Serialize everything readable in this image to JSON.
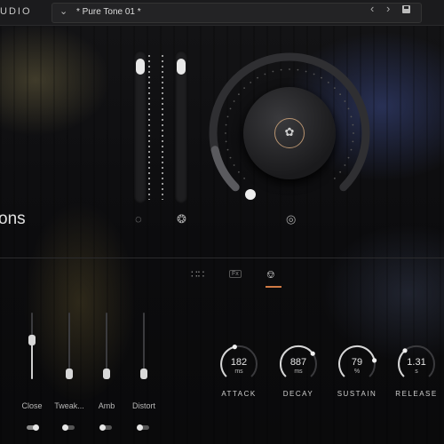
{
  "header": {
    "brand": "UDIO",
    "preset_name": "* Pure Tone 01 *",
    "chevron_icon": "chevron-down-icon",
    "prev_icon": "chevron-left-icon",
    "next_icon": "chevron-right-icon",
    "save_icon": "save-icon"
  },
  "left_panel": {
    "title_fragment": "ons"
  },
  "main_controls": {
    "slider_1_level": 0.95,
    "slider_2_level": 0.95,
    "slider_1_icon": "circles-icon",
    "slider_2_icon": "aperture-icon",
    "knob_icon": "sparkle-badge-icon",
    "knob_level": 0.12,
    "knob_footer_icon": "target-icon",
    "accent": "#d07a45"
  },
  "tabs": [
    {
      "name": "grid-tab",
      "icon": "grid-icon"
    },
    {
      "name": "fx-tab",
      "icon": "fx-icon",
      "label": "Fx"
    },
    {
      "name": "mixer-tab",
      "icon": "sliders-icon",
      "active": true
    }
  ],
  "macros": [
    {
      "label": "Close",
      "level": 0.6,
      "toggle_on": true
    },
    {
      "label": "Tweak...",
      "level": 0.0,
      "toggle_on": false
    },
    {
      "label": "Amb",
      "level": 0.0,
      "toggle_on": false
    },
    {
      "label": "Distort",
      "level": 0.0,
      "toggle_on": false
    }
  ],
  "envelope": [
    {
      "label": "ATTACK",
      "value": "182",
      "unit": "ms",
      "level": 0.45
    },
    {
      "label": "DECAY",
      "value": "887",
      "unit": "ms",
      "level": 0.7
    },
    {
      "label": "SUSTAIN",
      "value": "79",
      "unit": "%",
      "level": 0.79
    },
    {
      "label": "RELEASE",
      "value": "1.31",
      "unit": "s",
      "level": 0.35
    }
  ]
}
